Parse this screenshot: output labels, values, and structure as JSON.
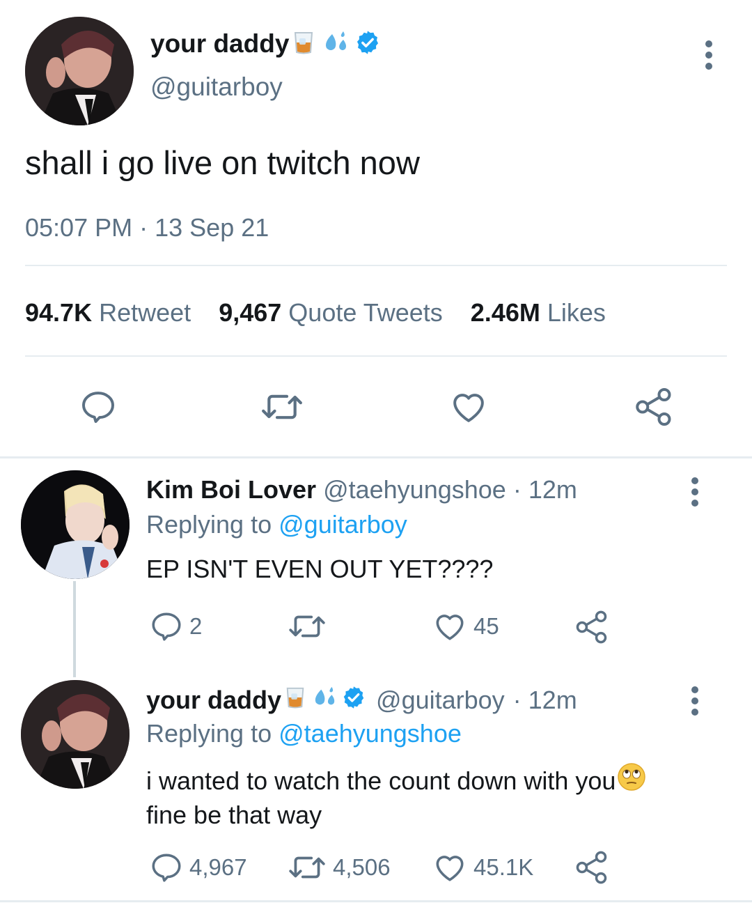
{
  "main_tweet": {
    "display_name": "your daddy",
    "handle": "@guitarboy",
    "text": "shall i go live on twitch now",
    "time": "05:07 PM",
    "separator": "·",
    "date": "13 Sep 21",
    "stats": {
      "retweets": "94.7K",
      "retweets_label": "Retweet",
      "quotes": "9,467",
      "quotes_label": "Quote Tweets",
      "likes": "2.46M",
      "likes_label": "Likes"
    }
  },
  "replies": [
    {
      "display_name": "Kim Boi Lover",
      "handle": "@taehyungshoe",
      "time": "· 12m",
      "replying_label": "Replying to",
      "replying_to": "@guitarboy",
      "text": "EP ISN'T EVEN OUT YET????",
      "reply_count": "2",
      "retweet_count": "",
      "like_count": "45"
    },
    {
      "display_name": "your daddy",
      "handle": "@guitarboy",
      "time": "· 12m",
      "replying_label": "Replying to",
      "replying_to": "@taehyungshoe",
      "text_line1": "i wanted to watch the count down with you",
      "text_line2": "fine be that way",
      "reply_count": "4,967",
      "retweet_count": "4,506",
      "like_count": "45.1K"
    }
  ],
  "colors": {
    "accent": "#1da1f2",
    "secondary_text": "#5b7083",
    "primary_text": "#14171a",
    "divider": "#e6ecf0"
  },
  "icons": [
    "tumbler-glass-emoji",
    "sweat-droplets-emoji",
    "verified-badge-icon",
    "more-options-icon",
    "reply-icon",
    "retweet-icon",
    "like-icon",
    "share-icon",
    "face-with-rolling-eyes-emoji"
  ]
}
